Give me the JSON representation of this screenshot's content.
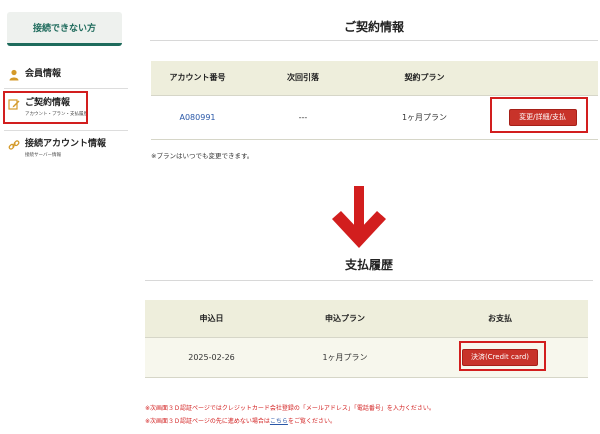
{
  "sidebar": {
    "cannot_connect_label": "接続できない方",
    "items": [
      {
        "label": "会員情報",
        "sub": ""
      },
      {
        "label": "ご契約情報",
        "sub": "アカウント・プラン・支払履歴"
      },
      {
        "label": "接続アカウント情報",
        "sub": "接続サーバー情報"
      }
    ]
  },
  "contract": {
    "title": "ご契約情報",
    "headers": [
      "アカウント番号",
      "次回引落",
      "契約プラン",
      ""
    ],
    "row": {
      "account": "A080991",
      "next_withdrawal": "---",
      "plan": "1ヶ月プラン",
      "button": "変更/詳細/支払"
    },
    "note": "※プランはいつでも変更できます。"
  },
  "payment": {
    "title": "支払履歴",
    "headers": [
      "申込日",
      "申込プラン",
      "お支払"
    ],
    "row": {
      "date": "2025-02-26",
      "plan": "1ヶ月プラン",
      "button": "決済(Credit card)"
    },
    "note1": "※次画面３Ｄ認証ページではクレジットカード会社登録の「メールアドレス」「電話番号」を入力ください。",
    "note2_prefix": "※次画面３Ｄ認証ページの先に進めない場合は",
    "note2_link": "こちら",
    "note2_suffix": "をご覧ください。"
  },
  "colors": {
    "accent": "#1e6b5c",
    "red": "#d21e1e",
    "button": "#c8332a",
    "header_bg": "#eeeedc"
  }
}
